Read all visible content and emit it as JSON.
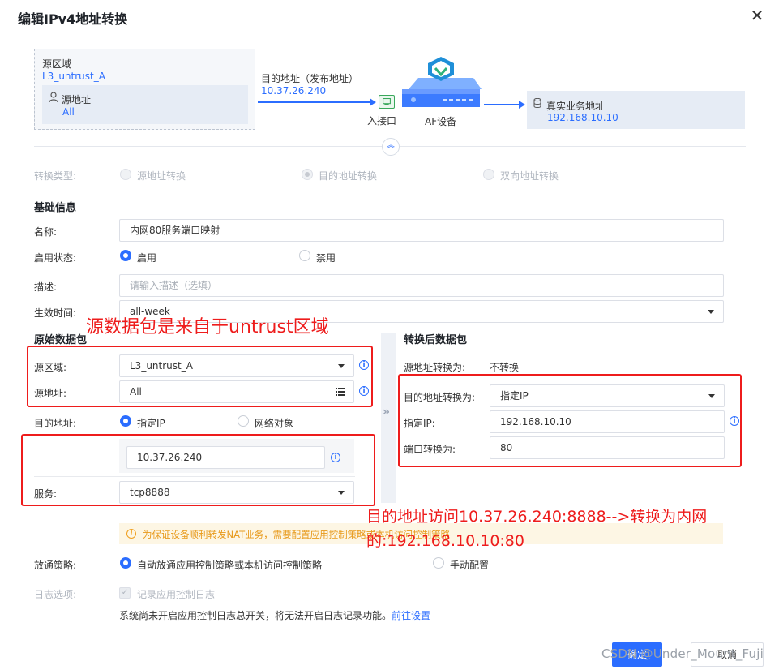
{
  "dialog": {
    "title": "编辑IPv4地址转换"
  },
  "topology": {
    "src_zone_label": "源区域",
    "src_zone_value": "L3_untrust_A",
    "src_addr_label": "源地址",
    "src_addr_value": "All",
    "dst_label": "目的地址（发布地址）",
    "dst_value": "10.37.26.240",
    "port_label": "入接口",
    "device_label": "AF设备",
    "real_label": "真实业务地址",
    "real_value": "192.168.10.10"
  },
  "conversion_type": {
    "label": "转换类型:",
    "options": [
      "源地址转换",
      "目的地址转换",
      "双向地址转换"
    ],
    "selected": "目的地址转换"
  },
  "basic": {
    "title": "基础信息",
    "name_label": "名称:",
    "name_value": "内网80服务端口映射",
    "status_label": "启用状态:",
    "status_on": "启用",
    "status_off": "禁用",
    "desc_label": "描述:",
    "desc_placeholder": "请输入描述（选填）",
    "time_label": "生效时间:",
    "time_value": "all-week"
  },
  "original": {
    "title": "原始数据包",
    "src_zone_label": "源区域:",
    "src_zone_value": "L3_untrust_A",
    "src_addr_label": "源地址:",
    "src_addr_value": "All",
    "dst_label": "目的地址:",
    "dst_opt_ip": "指定IP",
    "dst_opt_net": "网络对象",
    "dst_ip_value": "10.37.26.240",
    "service_label": "服务:",
    "service_value": "tcp8888"
  },
  "converted": {
    "title": "转换后数据包",
    "src_conv_label": "源地址转换为:",
    "src_conv_value": "不转换",
    "dst_conv_label": "目的地址转换为:",
    "dst_conv_value": "指定IP",
    "ip_label": "指定IP:",
    "ip_value": "192.168.10.10",
    "port_label": "端口转换为:",
    "port_value": "80"
  },
  "annotations": {
    "note1": "源数据包是来自于untrust区域",
    "note2_line1": "目的地址访问10.37.26.240:8888-->转换为内网",
    "note2_line2": "的:192.168.10.10:80"
  },
  "warning": {
    "text": "为保证设备顺利转发NAT业务，需要配置应用控制策略或本机访问控制策略"
  },
  "policy": {
    "label": "放通策略:",
    "opt_auto": "自动放通应用控制策略或本机访问控制策略",
    "opt_manual": "手动配置"
  },
  "log": {
    "label": "日志选项:",
    "checkbox_label": "记录应用控制日志",
    "hint": "系统尚未开启应用控制日志总开关，将无法开启日志记录功能。",
    "link": "前往设置"
  },
  "footer": {
    "ok_label": "确定",
    "cancel_label": "取消",
    "watermark": "CSDN @Under_Mount_Fuji"
  },
  "colors": {
    "primary": "#2b6dff",
    "annotation_red": "#ee1c1c",
    "warning": "#e89a1c"
  }
}
